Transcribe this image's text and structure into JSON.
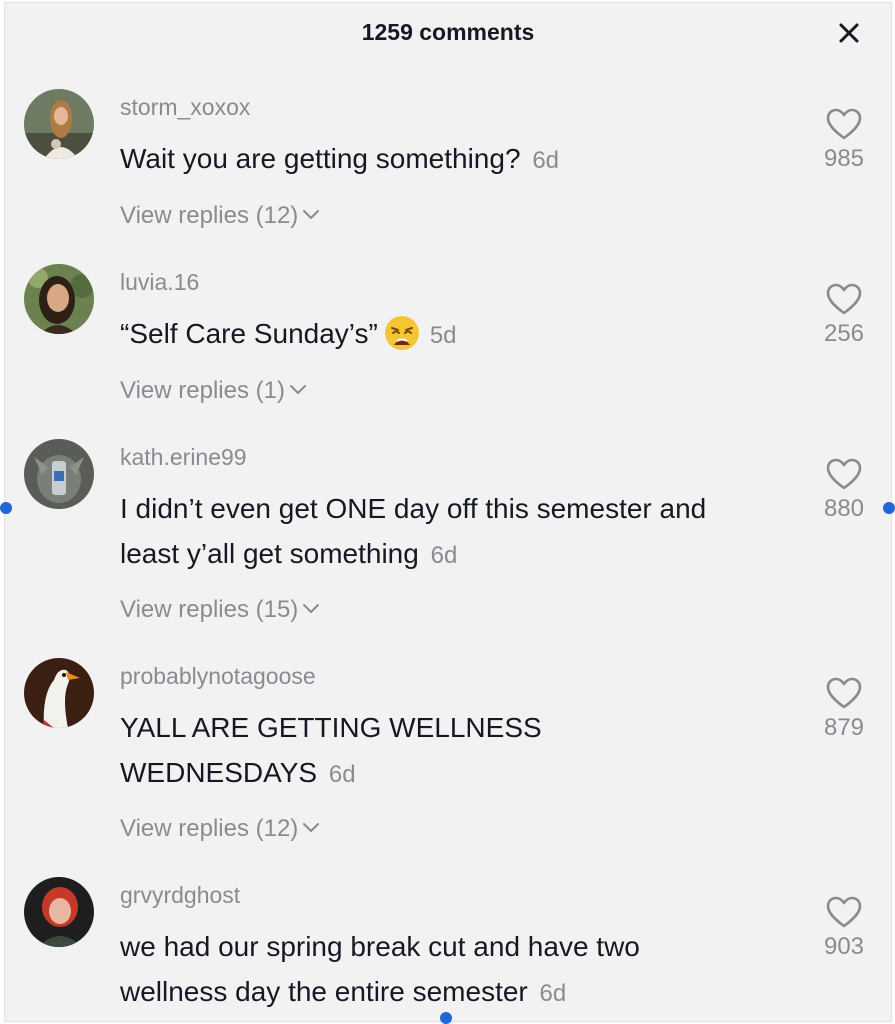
{
  "header": {
    "title": "1259 comments",
    "close_icon": "close-icon"
  },
  "comments": [
    {
      "username": "storm_xoxox",
      "text": "Wait you are getting something?",
      "time": "6d",
      "replies": "View replies (12)",
      "likes": "985"
    },
    {
      "username": "luvia.16",
      "text": "“Self Care Sunday’s”",
      "emoji": "weary-face-emoji",
      "time": "5d",
      "replies": "View replies (1)",
      "likes": "256"
    },
    {
      "username": "kath.erine99",
      "text": "I didn’t even get ONE day off this semester and least y’all get something",
      "time": "6d",
      "replies": "View replies (15)",
      "likes": "880"
    },
    {
      "username": "probablynotagoose",
      "text": "YALL ARE GETTING WELLNESS WEDNESDAYS",
      "time": "6d",
      "replies": "View replies (12)",
      "likes": "879"
    },
    {
      "username": "grvyrdghost",
      "text": "we had our spring break cut and have two wellness day the entire semester",
      "time": "6d",
      "likes": "903"
    }
  ],
  "colors": {
    "background": "#f3f2f2",
    "primary_text": "#161823",
    "secondary_text": "#8a8b91",
    "selection_handle": "#1f66d6"
  }
}
